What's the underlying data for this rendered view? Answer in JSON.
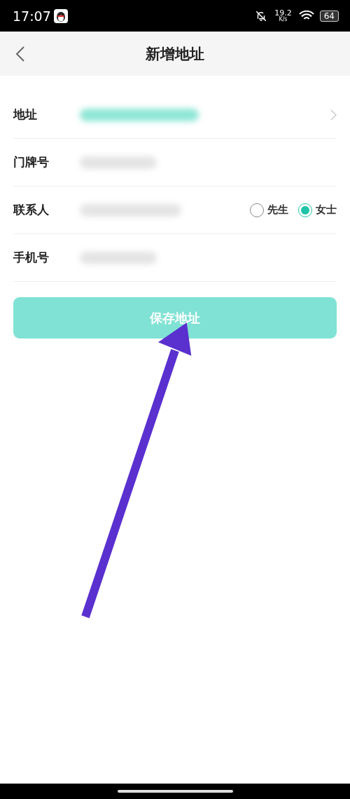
{
  "status_bar": {
    "time": "17:07",
    "speed": "19.2",
    "speed_unit": "K/s",
    "battery": "64"
  },
  "nav": {
    "title": "新增地址"
  },
  "rows": [
    {
      "label": "地址",
      "kind": "address"
    },
    {
      "label": "门牌号",
      "kind": "text"
    },
    {
      "label": "联系人",
      "kind": "contact",
      "options": [
        {
          "label": "先生",
          "selected": false
        },
        {
          "label": "女士",
          "selected": true
        }
      ]
    },
    {
      "label": "手机号",
      "kind": "text"
    }
  ],
  "save_button": "保存地址"
}
